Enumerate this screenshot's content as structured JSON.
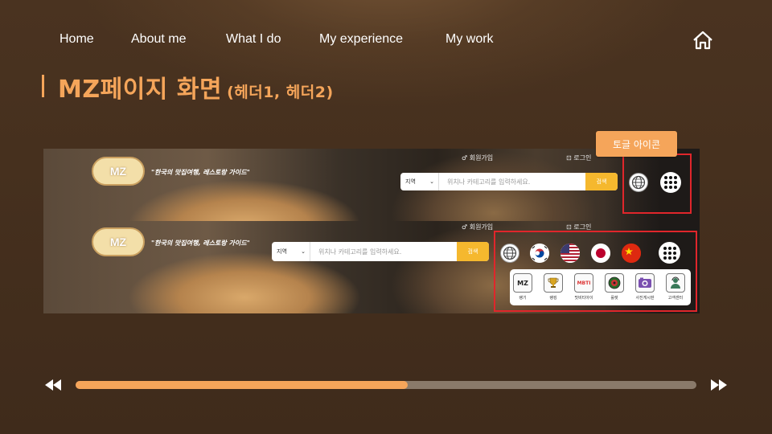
{
  "nav": {
    "items": [
      {
        "label": "Home"
      },
      {
        "label": "About me"
      },
      {
        "label": "What I do"
      },
      {
        "label": "My experience"
      },
      {
        "label": "My work"
      }
    ],
    "home_icon": "home-icon"
  },
  "title": {
    "main": "MZ페이지 화면",
    "sub": "(헤더1, 헤더2)",
    "accent": "#f5a55a"
  },
  "screenshot": {
    "logo_text": "MZ",
    "tagline": "\"한국의 맛집여행, 레스토랑 가이드\"",
    "signup": "♂ 회원가입",
    "login": "⊡ 로그인",
    "search_region": "지역",
    "search_placeholder": "위치나 카테고리를 입력하세요.",
    "search_button": "검색",
    "flags": [
      "korea-flag-icon",
      "usa-flag-icon",
      "japan-flag-icon",
      "china-flag-icon"
    ],
    "apps": [
      {
        "icon": "mz-icon",
        "label": "랭기"
      },
      {
        "icon": "trophy-icon",
        "label": "랭킹"
      },
      {
        "icon": "mbti-icon",
        "label": "맛비티아이"
      },
      {
        "icon": "roulette-icon",
        "label": "룰렛"
      },
      {
        "icon": "photo-board-icon",
        "label": "사진게시판"
      },
      {
        "icon": "customer-center-icon",
        "label": "고객센터"
      }
    ],
    "mbti_text": "MBTI"
  },
  "badge": {
    "label": "토글 아이콘"
  },
  "progress": {
    "value": 0.535,
    "fill_color": "#f5a55a",
    "track_color": "#8a7a6a"
  }
}
